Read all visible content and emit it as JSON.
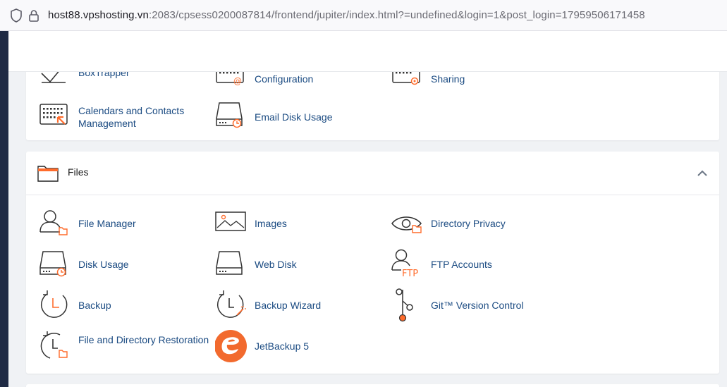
{
  "browser": {
    "url_host": "host88.vpshosting.vn",
    "url_rest": ":2083/cpsess0200087814/frontend/jupiter/index.html?=undefined&login=1&post_login=17959506171458"
  },
  "email_section": {
    "items": [
      {
        "label": "BoxTrapper",
        "icon": "boxtrapper-icon"
      },
      {
        "label": "Configuration",
        "icon": "email-configuration-icon"
      },
      {
        "label": "Sharing",
        "icon": "calendar-sharing-icon"
      },
      {
        "label": "Calendars and Contacts Management",
        "icon": "calendars-contacts-icon"
      },
      {
        "label": "Email Disk Usage",
        "icon": "email-disk-usage-icon"
      }
    ]
  },
  "files_section": {
    "title": "Files",
    "items": [
      {
        "label": "File Manager",
        "icon": "file-manager-icon"
      },
      {
        "label": "Images",
        "icon": "images-icon"
      },
      {
        "label": "Directory Privacy",
        "icon": "directory-privacy-icon"
      },
      {
        "label": "Disk Usage",
        "icon": "disk-usage-icon"
      },
      {
        "label": "Web Disk",
        "icon": "web-disk-icon"
      },
      {
        "label": "FTP Accounts",
        "icon": "ftp-accounts-icon"
      },
      {
        "label": "Backup",
        "icon": "backup-icon"
      },
      {
        "label": "Backup Wizard",
        "icon": "backup-wizard-icon"
      },
      {
        "label": "Git™ Version Control",
        "icon": "git-icon"
      },
      {
        "label": "File and Directory Restoration",
        "icon": "file-restoration-icon"
      },
      {
        "label": "JetBackup 5",
        "icon": "jetbackup-icon"
      }
    ]
  },
  "ftp_icon_text": "FTP",
  "colors": {
    "accent": "#ff6c2c",
    "link": "#1b4b82",
    "rail": "#1f2a44"
  }
}
